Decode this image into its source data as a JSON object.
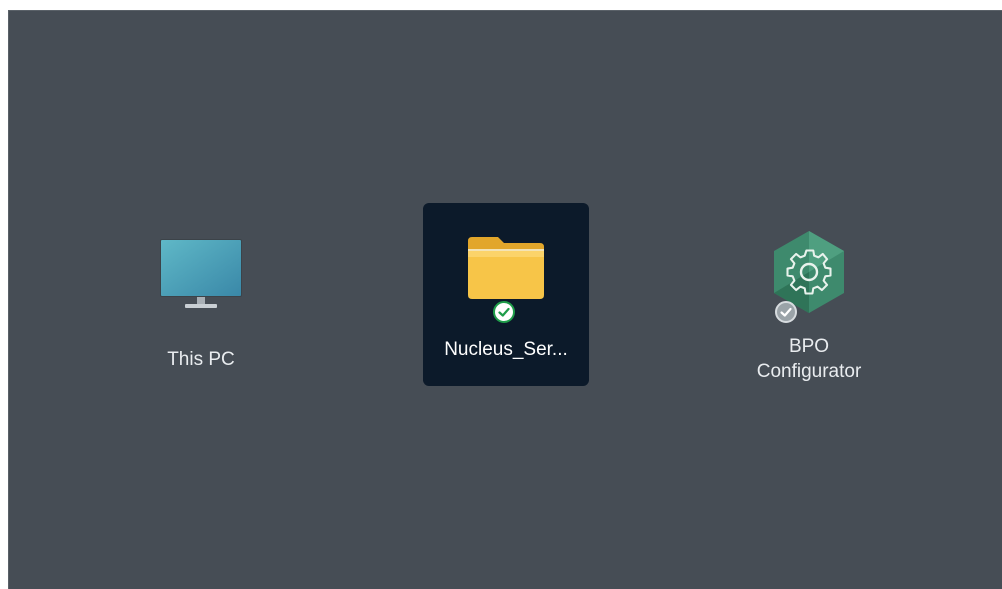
{
  "desktop": {
    "items": [
      {
        "label": "This PC",
        "icon": "monitor-icon",
        "selected": false
      },
      {
        "label": "Nucleus_Ser...",
        "icon": "folder-icon",
        "badge": "sync-ok",
        "selected": true
      },
      {
        "label": "BPO\nConfigurator",
        "icon": "gear-hexagon-icon",
        "badge": "sync-ok-grey",
        "selected": false
      }
    ]
  },
  "colors": {
    "desktop_bg": "#464d55",
    "selection_bg": "#0c1a2a",
    "folder": "#f7c548",
    "status_green": "#1f9d4a",
    "app_green": "#3e8a6d"
  }
}
